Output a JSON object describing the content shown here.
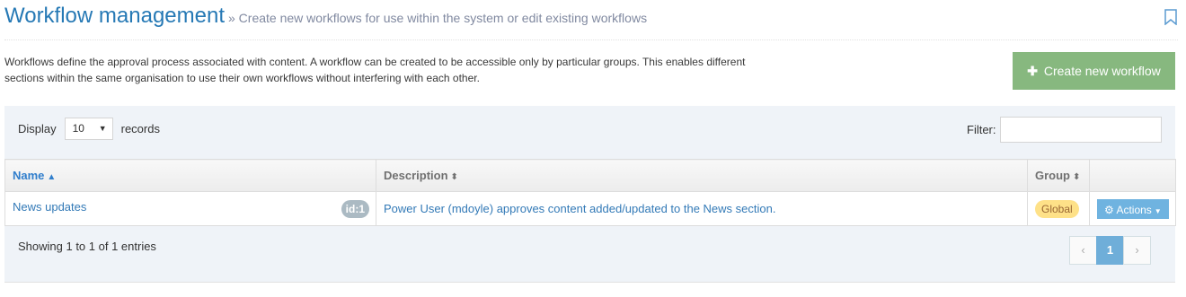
{
  "header": {
    "title": "Workflow management",
    "subtitle": "» Create new workflows for use within the system or edit existing workflows"
  },
  "intro": "Workflows define the approval process associated with content. A workflow can be created to be accessible only by particular groups. This enables different sections within the same organisation to use their own workflows without interfering with each other.",
  "create_button": {
    "icon": "plus-icon",
    "label": "Create new workflow"
  },
  "controls": {
    "display_label": "Display",
    "records_label": "records",
    "page_length": "10",
    "filter_label": "Filter:",
    "filter_value": ""
  },
  "table": {
    "columns": [
      {
        "label": "Name",
        "sort": "asc"
      },
      {
        "label": "Description",
        "sort": "both"
      },
      {
        "label": "Group",
        "sort": "both"
      },
      {
        "label": ""
      }
    ],
    "rows": [
      {
        "name": "News updates",
        "id_badge": "id:1",
        "description": "Power User (mdoyle) approves content added/updated to the News section.",
        "group": "Global",
        "actions_label": "Actions"
      }
    ]
  },
  "footer": {
    "info": "Showing 1 to 1 of 1 entries",
    "prev": "‹",
    "current_page": "1",
    "next": "›"
  },
  "colors": {
    "title": "#2679b5",
    "create_button": "#87b87f",
    "actions_button": "#6fb3e0",
    "group_badge": "#fee188",
    "active_page": "#6faed9"
  }
}
